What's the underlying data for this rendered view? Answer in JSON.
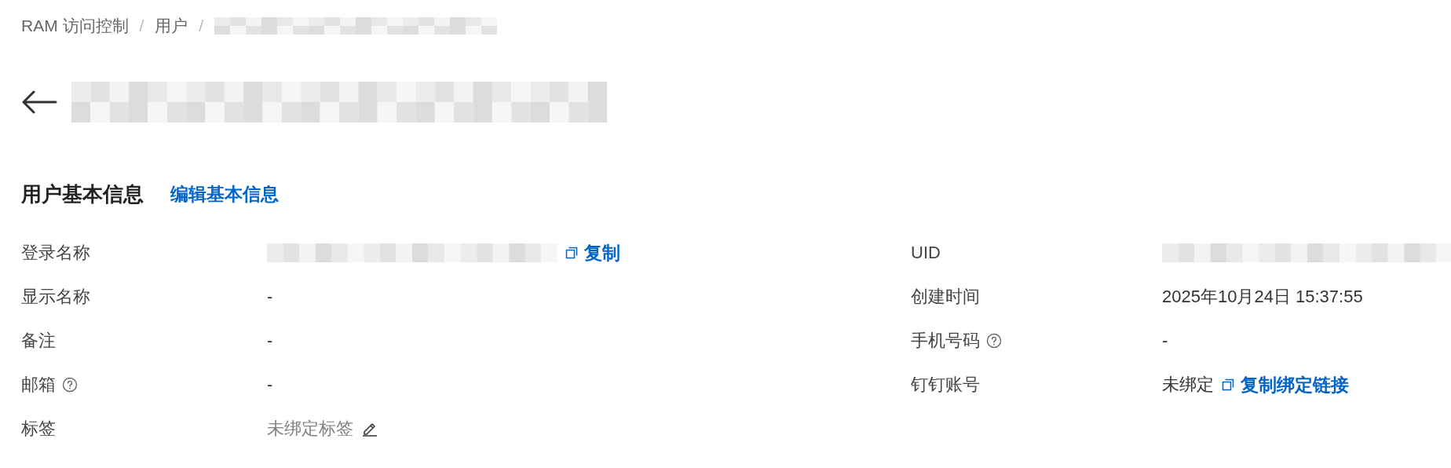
{
  "breadcrumb": [
    {
      "kind": "link",
      "label": "RAM 访问控制"
    },
    {
      "kind": "separator",
      "label": "/"
    },
    {
      "kind": "link",
      "label": "用户"
    },
    {
      "kind": "separator",
      "label": "/"
    },
    {
      "kind": "redacted"
    }
  ],
  "section": {
    "title": "用户基本信息",
    "edit_link": "编辑基本信息"
  },
  "rows": [
    {
      "left": {
        "label": "登录名称",
        "kind": "redacted",
        "copy_label": "复制"
      },
      "right": {
        "label": "UID",
        "kind": "redacted"
      }
    },
    {
      "left": {
        "label": "显示名称",
        "kind": "text",
        "value": "-"
      },
      "right": {
        "label": "创建时间",
        "kind": "text",
        "value": "2025年10月24日 15:37:55"
      }
    },
    {
      "left": {
        "label": "备注",
        "kind": "text",
        "value": "-"
      },
      "right": {
        "label": "手机号码",
        "help": true,
        "kind": "text",
        "value": "-"
      }
    },
    {
      "left": {
        "label": "邮箱",
        "help": true,
        "kind": "text",
        "value": "-"
      },
      "right": {
        "label": "钉钉账号",
        "kind": "text",
        "value": "未绑定",
        "copy_label": "复制绑定链接"
      }
    },
    {
      "left": {
        "label": "标签",
        "kind": "tag",
        "value": "未绑定标签"
      }
    }
  ]
}
